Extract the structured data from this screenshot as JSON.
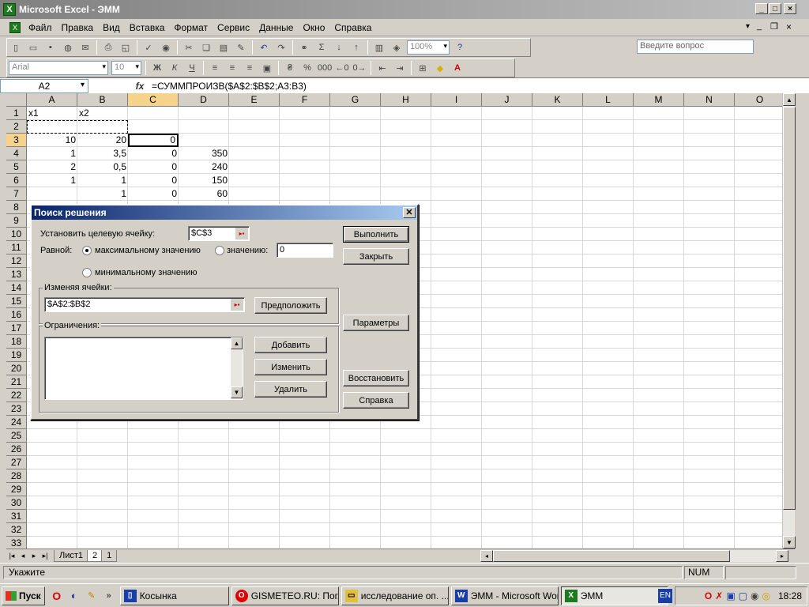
{
  "window": {
    "title": "Microsoft Excel - ЭММ"
  },
  "menu": [
    "Файл",
    "Правка",
    "Вид",
    "Вставка",
    "Формат",
    "Сервис",
    "Данные",
    "Окно",
    "Справка"
  ],
  "ask_placeholder": "Введите вопрос",
  "toolbar": {
    "zoom": "100%",
    "font": "Arial",
    "font_size": "10"
  },
  "formula_bar": {
    "cell": "A2",
    "fx": "fx",
    "formula": "=СУММПРОИЗВ($A$2:$B$2;A3:B3)"
  },
  "columns": [
    "A",
    "B",
    "C",
    "D",
    "E",
    "F",
    "G",
    "H",
    "I",
    "J",
    "K",
    "L",
    "M",
    "N",
    "O"
  ],
  "rows": [
    "1",
    "2",
    "3",
    "4",
    "5",
    "6",
    "7",
    "8",
    "9",
    "10",
    "11",
    "12",
    "13",
    "14",
    "15",
    "16",
    "17",
    "18",
    "19",
    "20",
    "21",
    "22",
    "23",
    "24",
    "25",
    "26",
    "27",
    "28",
    "29",
    "30",
    "31",
    "32",
    "33"
  ],
  "cells": {
    "A1": "x1",
    "B1": "x2",
    "A3": "10",
    "B3": "20",
    "C3": "0",
    "A4": "1",
    "B4": "3,5",
    "C4": "0",
    "D4": "350",
    "A5": "2",
    "B5": "0,5",
    "C5": "0",
    "D5": "240",
    "A6": "1",
    "B6": "1",
    "C6": "0",
    "D6": "150",
    "B7": "1",
    "C7": "0",
    "D7": "60"
  },
  "sheet_tabs": [
    "Лист1",
    "2",
    "1"
  ],
  "status": {
    "left": "Укажите",
    "num": "NUM"
  },
  "dialog": {
    "title": "Поиск решения",
    "target_label": "Установить целевую ячейку:",
    "target_value": "$C$3",
    "equal_label": "Равной:",
    "max_label": "максимальному значению",
    "value_label": "значению:",
    "value_input": "0",
    "min_label": "минимальному значению",
    "changing_label": "Изменяя ячейки:",
    "changing_value": "$A$2:$B$2",
    "constraints_label": "Ограничения:",
    "buttons": {
      "run": "Выполнить",
      "close": "Закрыть",
      "params": "Параметры",
      "restore": "Восстановить",
      "help": "Справка",
      "guess": "Предположить",
      "add": "Добавить",
      "change": "Изменить",
      "delete": "Удалить"
    }
  },
  "taskbar": {
    "start": "Пуск",
    "tasks": [
      "Косынка",
      "GISMETEO.RU: Пог...",
      "исследование оп. ...",
      "ЭММ - Microsoft Word",
      "ЭММ"
    ],
    "lang": "EN",
    "clock": "18:28"
  }
}
